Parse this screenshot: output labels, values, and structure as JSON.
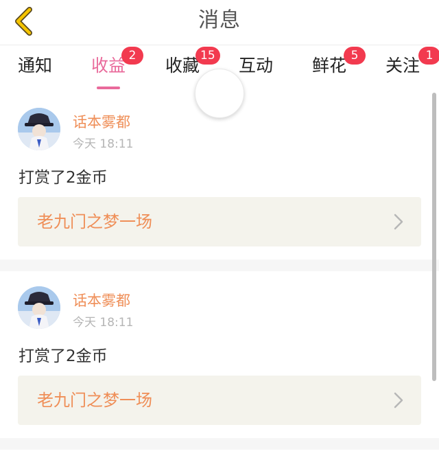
{
  "header": {
    "title": "消息",
    "back_icon": "chevron-left-icon",
    "back_color": "#f5c400"
  },
  "tabs": [
    {
      "label": "通知",
      "badge": ""
    },
    {
      "label": "收益",
      "badge": "2",
      "active": true
    },
    {
      "label": "收藏",
      "badge": "15"
    },
    {
      "label": "互动",
      "badge": ""
    },
    {
      "label": "鲜花",
      "badge": "5"
    },
    {
      "label": "关注",
      "badge": "1"
    }
  ],
  "colors": {
    "active_tab": "#e96a9b",
    "badge": "#f23a4f",
    "accent_text": "#ef8e57"
  },
  "messages": [
    {
      "username": "话本雾都",
      "time": "今天 18:11",
      "action": "打赏了2金币",
      "book": "老九门之梦一场"
    },
    {
      "username": "话本雾都",
      "time": "今天 18:11",
      "action": "打赏了2金币",
      "book": "老九门之梦一场"
    }
  ]
}
